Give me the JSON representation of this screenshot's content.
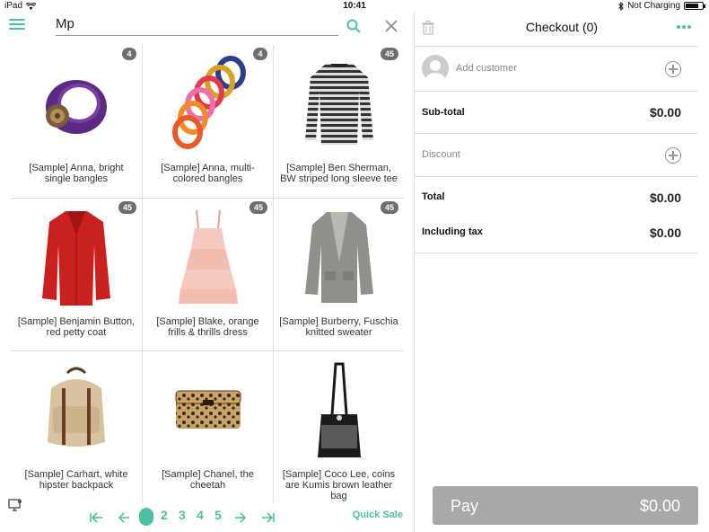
{
  "status_bar": {
    "device": "iPad",
    "time": "10:41",
    "charging": "Not Charging"
  },
  "search": {
    "value": "Mp"
  },
  "products": [
    {
      "name": "[Sample] Anna, bright single bangles",
      "count": "4",
      "image": "purple-bangle"
    },
    {
      "name": "[Sample] Anna, multi-colored bangles",
      "count": "4",
      "image": "multi-bangles"
    },
    {
      "name": "[Sample] Ben Sherman, BW striped long sleeve tee",
      "count": "45",
      "image": "striped-tee"
    },
    {
      "name": "[Sample] Benjamin Button, red petty coat",
      "count": "45",
      "image": "red-coat"
    },
    {
      "name": "[Sample] Blake, orange frills & thrills dress",
      "count": "45",
      "image": "pink-dress"
    },
    {
      "name": "[Sample] Burberry, Fuschia knitted sweater",
      "count": "45",
      "image": "grey-cardigan"
    },
    {
      "name": "[Sample] Carhart, white hipster backpack",
      "count": "",
      "image": "backpack"
    },
    {
      "name": "[Sample] Chanel, the cheetah",
      "count": "",
      "image": "cheetah-clutch"
    },
    {
      "name": "[Sample] Coco Lee, coins are Kumis brown leather bag",
      "count": "",
      "image": "leather-bag"
    }
  ],
  "pagination": {
    "pages": [
      "1",
      "2",
      "3",
      "4",
      "5"
    ],
    "active": "1",
    "quick_sale": "Quick Sale"
  },
  "checkout": {
    "title": "Checkout (0)",
    "add_customer": "Add customer",
    "subtotal_label": "Sub-total",
    "subtotal_value": "$0.00",
    "discount_label": "Discount",
    "total_label": "Total",
    "total_value": "$0.00",
    "tax_label": "Including tax",
    "tax_value": "$0.00",
    "pay_label": "Pay",
    "pay_value": "$0.00"
  },
  "colors": {
    "accent": "#4fbfa3",
    "pay_button": "#a8a8a8"
  }
}
